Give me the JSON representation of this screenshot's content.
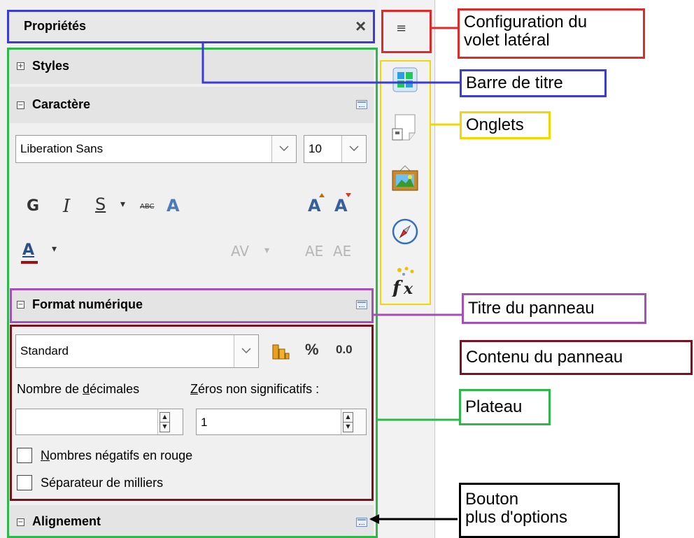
{
  "panel": {
    "title": "Propriétés",
    "close_glyph": "×"
  },
  "sections": {
    "styles": "Styles",
    "caractere": "Caractère",
    "format": "Format numérique",
    "alignement": "Alignement"
  },
  "character": {
    "font_name": "Liberation Sans",
    "font_size": "10",
    "bold": "G",
    "italic": "I",
    "shadow": "S",
    "strike": "ABC",
    "outline": "A",
    "grow": "A",
    "shrink": "A",
    "font_color": "A",
    "spacing": "AV",
    "upper": "AE",
    "lower": "AE"
  },
  "number_format": {
    "category": "Standard",
    "currency_label": "",
    "percent_label": "%",
    "decimal_label": "0.0",
    "decimals_label_pre": "Nombre de ",
    "decimals_label_u": "d",
    "decimals_label_post": "écimales",
    "zeros_label_u": "Z",
    "zeros_label_post": "éros non significatifs :",
    "decimals_value": "",
    "zeros_value": "1",
    "neg_red_u": "N",
    "neg_red_post": "ombres négatifs en rouge",
    "thousands": "Séparateur de milliers"
  },
  "sidebar_menu_glyph": "≡",
  "tabs": [
    {
      "icon": "styles-icon"
    },
    {
      "icon": "navigator-page-icon"
    },
    {
      "icon": "gallery-icon"
    },
    {
      "icon": "navigator-icon"
    },
    {
      "icon": "function-wizard-icon"
    }
  ],
  "callouts": {
    "config": "Configuration du\nvolet latéral",
    "titlebar": "Barre de titre",
    "tabs": "Onglets",
    "panel_title": "Titre du panneau",
    "panel_content": "Contenu du panneau",
    "deck": "Plateau",
    "more_options": "Bouton\nplus d'options"
  },
  "colors": {
    "red": "#e02a2a",
    "blue": "#3b3bd6",
    "yellow": "#f0d800",
    "purple": "#a450b4",
    "maroon": "#7a1020",
    "green": "#2fb84a",
    "black": "#000000"
  }
}
